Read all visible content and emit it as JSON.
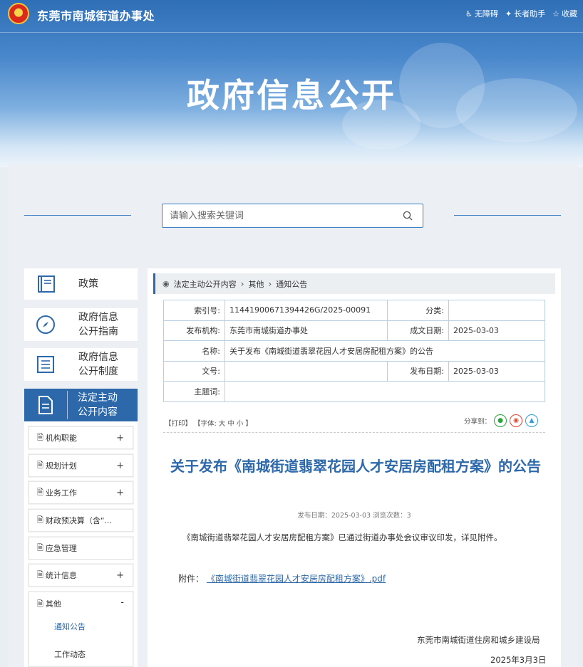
{
  "header": {
    "site_name": "东莞市南城街道办事处",
    "hero_title": "政府信息公开",
    "links": [
      {
        "icon": "accessibility-icon",
        "label": "无障碍"
      },
      {
        "icon": "elderly-helper-icon",
        "label": "长者助手"
      },
      {
        "icon": "star-icon",
        "label": "收藏"
      }
    ]
  },
  "search": {
    "placeholder": "请输入搜索关键词"
  },
  "sidebar": {
    "main_items": [
      {
        "label": "政策",
        "icon": "book-icon"
      },
      {
        "label": "政府信息公开指南",
        "line1": "政府信息",
        "line2": "公开指南",
        "icon": "compass-icon"
      },
      {
        "label": "政府信息公开制度",
        "line1": "政府信息",
        "line2": "公开制度",
        "icon": "list-icon"
      },
      {
        "label": "法定主动公开内容",
        "line1": "法定主动",
        "line2": "公开内容",
        "icon": "document-icon",
        "active": true
      }
    ],
    "sub_items": [
      {
        "label": "机构职能",
        "toggle": "+"
      },
      {
        "label": "规划计划",
        "toggle": "+"
      },
      {
        "label": "业务工作",
        "toggle": "+"
      },
      {
        "label": "财政预决算（含“...",
        "toggle": ""
      },
      {
        "label": "应急管理",
        "toggle": ""
      },
      {
        "label": "统计信息",
        "toggle": "+"
      },
      {
        "label": "其他",
        "toggle": "-"
      }
    ],
    "children": [
      {
        "label": "通知公告",
        "active": true
      },
      {
        "label": "工作动态",
        "active": false
      }
    ]
  },
  "breadcrumb": [
    "法定主动公开内容",
    "其他",
    "通知公告"
  ],
  "meta": {
    "index_label": "索引号:",
    "index_value": "11441900671394426G/2025-00091",
    "category_label": "分类:",
    "category_value": "",
    "publisher_label": "发布机构:",
    "publisher_value": "东莞市南城街道办事处",
    "created_label": "成文日期:",
    "created_value": "2025-03-03",
    "name_label": "名称:",
    "name_value": "关于发布《南城街道翡翠花园人才安居房配租方案》的公告",
    "docno_label": "文号:",
    "docno_value": "",
    "pubdate_label": "发布日期:",
    "pubdate_value": "2025-03-03",
    "subject_label": "主题词:",
    "subject_value": ""
  },
  "tools": {
    "print": "【打印】",
    "font_label": "【字体:",
    "font_large": "大",
    "font_medium": "中",
    "font_small": "小",
    "font_end": "】",
    "share_label": "分享到："
  },
  "article": {
    "title": "关于发布《南城街道翡翠花园人才安居房配租方案》的公告",
    "pubinfo": "发布日期：2025-03-03  浏览次数：3",
    "body": "《南城街道翡翠花园人才安居房配租方案》已通过街道办事处会议审议印发，详见附件。",
    "attachment_label": "附件：",
    "attachment_link": "《南城街道翡翠花园人才安居房配租方案》.pdf",
    "signature": "东莞市南城街道住房和城乡建设局",
    "date": "2025年3月3日"
  },
  "colors": {
    "brand": "#2c68aa",
    "accent": "#3d7fc5"
  }
}
